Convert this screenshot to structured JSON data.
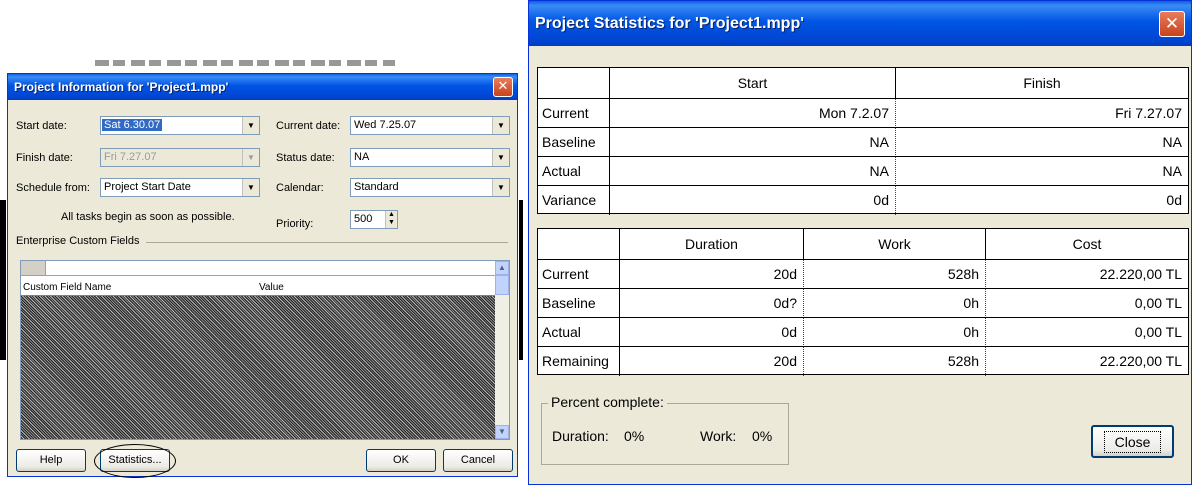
{
  "colors": {
    "titlebar": "#0055e5",
    "dialog_bg": "#ece9d8",
    "close_button": "#d9532c",
    "selection": "#316ac5"
  },
  "project_info": {
    "title": "Project Information for 'Project1.mpp'",
    "start_date_label": "Start date:",
    "start_date_value": "Sat 6.30.07",
    "finish_date_label": "Finish date:",
    "finish_date_value": "Fri 7.27.07",
    "schedule_from_label": "Schedule from:",
    "schedule_from_value": "Project Start Date",
    "schedule_note": "All tasks begin as soon as possible.",
    "current_date_label": "Current date:",
    "current_date_value": "Wed 7.25.07",
    "status_date_label": "Status date:",
    "status_date_value": "NA",
    "calendar_label": "Calendar:",
    "calendar_value": "Standard",
    "priority_label": "Priority:",
    "priority_value": "500",
    "enterprise_fields_label": "Enterprise Custom Fields",
    "grid_headers": [
      "Custom Field Name",
      "Value"
    ],
    "buttons": {
      "help": "Help",
      "statistics": "Statistics...",
      "ok": "OK",
      "cancel": "Cancel"
    }
  },
  "project_stats": {
    "title": "Project Statistics for 'Project1.mpp'",
    "dates_table": {
      "headers": [
        "Start",
        "Finish"
      ],
      "rows": [
        {
          "label": "Current",
          "start": "Mon 7.2.07",
          "finish": "Fri 7.27.07"
        },
        {
          "label": "Baseline",
          "start": "NA",
          "finish": "NA"
        },
        {
          "label": "Actual",
          "start": "NA",
          "finish": "NA"
        },
        {
          "label": "Variance",
          "start": "0d",
          "finish": "0d"
        }
      ]
    },
    "work_table": {
      "headers": [
        "Duration",
        "Work",
        "Cost"
      ],
      "rows": [
        {
          "label": "Current",
          "duration": "20d",
          "work": "528h",
          "cost": "22.220,00 TL"
        },
        {
          "label": "Baseline",
          "duration": "0d?",
          "work": "0h",
          "cost": "0,00 TL"
        },
        {
          "label": "Actual",
          "duration": "0d",
          "work": "0h",
          "cost": "0,00 TL"
        },
        {
          "label": "Remaining",
          "duration": "20d",
          "work": "528h",
          "cost": "22.220,00 TL"
        }
      ]
    },
    "percent_complete": {
      "label": "Percent complete:",
      "duration_label": "Duration:",
      "duration_value": "0%",
      "work_label": "Work:",
      "work_value": "0%"
    },
    "close_label": "Close"
  }
}
